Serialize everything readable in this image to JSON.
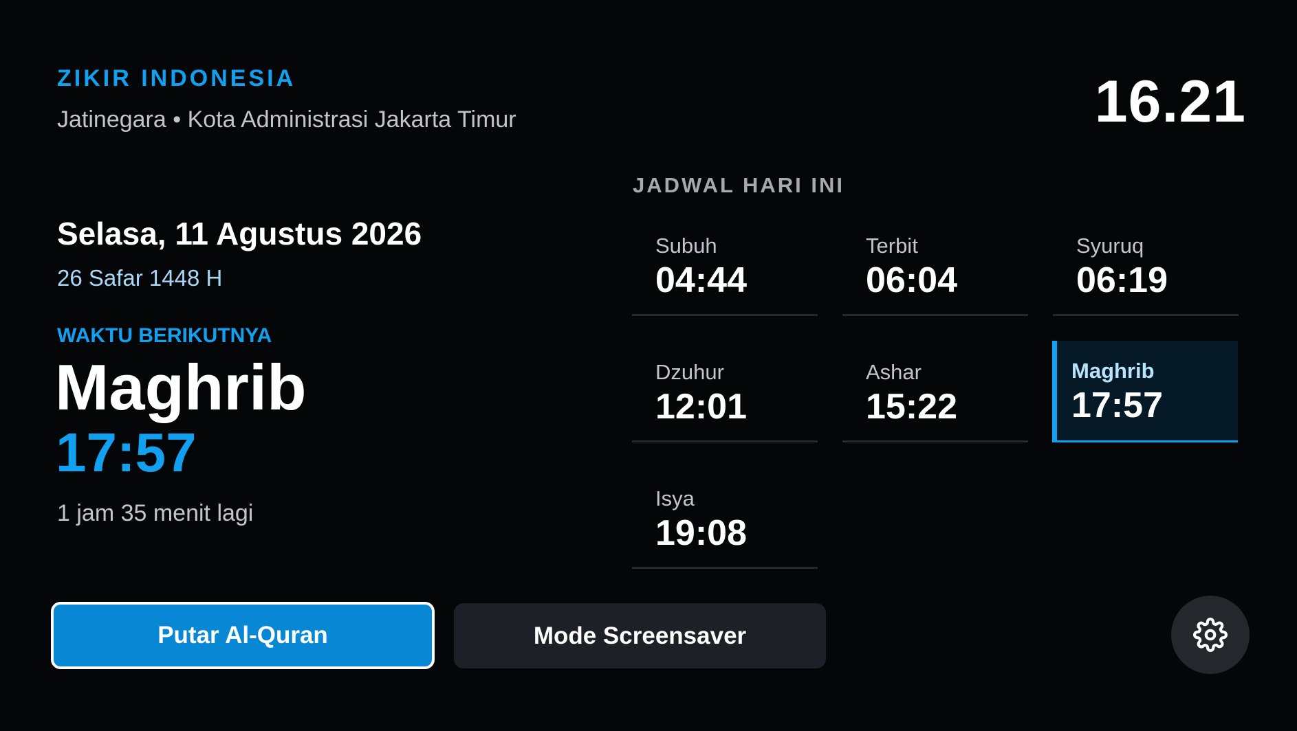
{
  "header": {
    "brand": "ZIKIR INDONESIA",
    "location": "Jatinegara • Kota Administrasi Jakarta Timur",
    "clock": "16.21"
  },
  "today": {
    "gregorian": "Selasa, 11 Agustus 2026",
    "hijri": "26 Safar 1448 H"
  },
  "next_prayer": {
    "label": "WAKTU BERIKUTNYA",
    "name": "Maghrib",
    "time": "17:57",
    "countdown": "1 jam 35 menit lagi"
  },
  "schedule": {
    "title": "JADWAL HARI INI",
    "items": [
      {
        "name": "Subuh",
        "time": "04:44"
      },
      {
        "name": "Terbit",
        "time": "06:04"
      },
      {
        "name": "Syuruq",
        "time": "06:19"
      },
      {
        "name": "Dzuhur",
        "time": "12:01"
      },
      {
        "name": "Ashar",
        "time": "15:22"
      },
      {
        "name": "Maghrib",
        "time": "17:57",
        "active": true
      },
      {
        "name": "Isya",
        "time": "19:08"
      }
    ]
  },
  "actions": {
    "play_quran": "Putar Al-Quran",
    "screensaver": "Mode Screensaver",
    "settings_icon": "gear-icon"
  },
  "colors": {
    "background": "#050608",
    "accent": "#12a0f0",
    "active_card_bg": "#051a26",
    "primary_button": "#0787d4",
    "secondary_button": "#1d2127"
  }
}
